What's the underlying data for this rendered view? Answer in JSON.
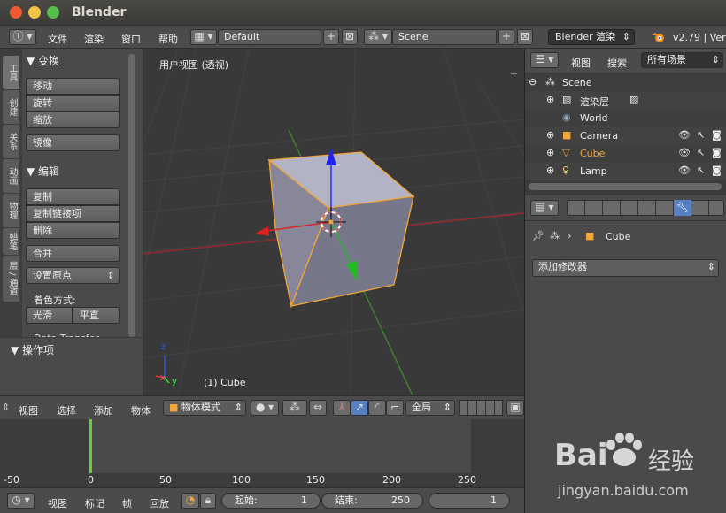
{
  "window": {
    "title": "Blender"
  },
  "info_header": {
    "menus": [
      "文件",
      "渲染",
      "窗口",
      "帮助"
    ],
    "screen_layout": "Default",
    "scene": "Scene",
    "render_engine": "Blender 渲染",
    "version": "v2.79 | Ver"
  },
  "tool_shelf": {
    "tabs": [
      "工具",
      "创建",
      "关系",
      "动画",
      "物理",
      "蜡笔",
      "层 / 通道"
    ],
    "transform_header": "▼ 变换",
    "transform_buttons": [
      "移动",
      "旋转",
      "缩放",
      "镜像"
    ],
    "edit_header": "▼ 编辑",
    "edit_buttons": [
      "复制",
      "复制链接项",
      "删除",
      "合并"
    ],
    "origin_dropdown": "设置原点",
    "shading_label": "着色方式:",
    "shading_buttons": [
      "光滑",
      "平直"
    ],
    "data_transfer": "Data Transfer",
    "operator_header": "▼ 操作项"
  },
  "viewport": {
    "title": "用户视图 (透视)",
    "selected_label": "(1) Cube",
    "axis_x": "x",
    "axis_y": "y",
    "axis_z": "z"
  },
  "view3d_header": {
    "menus": [
      "视图",
      "选择",
      "添加",
      "物体"
    ],
    "mode": "物体模式",
    "orientation": "全局"
  },
  "timeline": {
    "ruler_labels": [
      "-50",
      "0",
      "50",
      "100",
      "150",
      "200",
      "250"
    ],
    "current_frame": 1,
    "menus": [
      "视图",
      "标记",
      "帧",
      "回放"
    ],
    "start_label": "起始:",
    "start_value": "1",
    "end_label": "结束:",
    "end_value": "250",
    "frame_value": "1"
  },
  "outliner": {
    "view_menu": "视图",
    "search_menu": "搜索",
    "filter": "所有场景",
    "rows": [
      {
        "name": "Scene"
      },
      {
        "name": "渲染层"
      },
      {
        "name": "World"
      },
      {
        "name": "Camera"
      },
      {
        "name": "Cube"
      },
      {
        "name": "Lamp"
      }
    ]
  },
  "properties": {
    "object_name": "Cube",
    "add_modifier": "添加修改器"
  },
  "watermark": {
    "brand": "Bai",
    "brand_cn": "经验",
    "url": "jingyan.baidu.com"
  },
  "colors": {
    "accent_blue": "#5680c2",
    "selection_orange": "#f3a636",
    "timeline_cursor": "#5fd038"
  }
}
